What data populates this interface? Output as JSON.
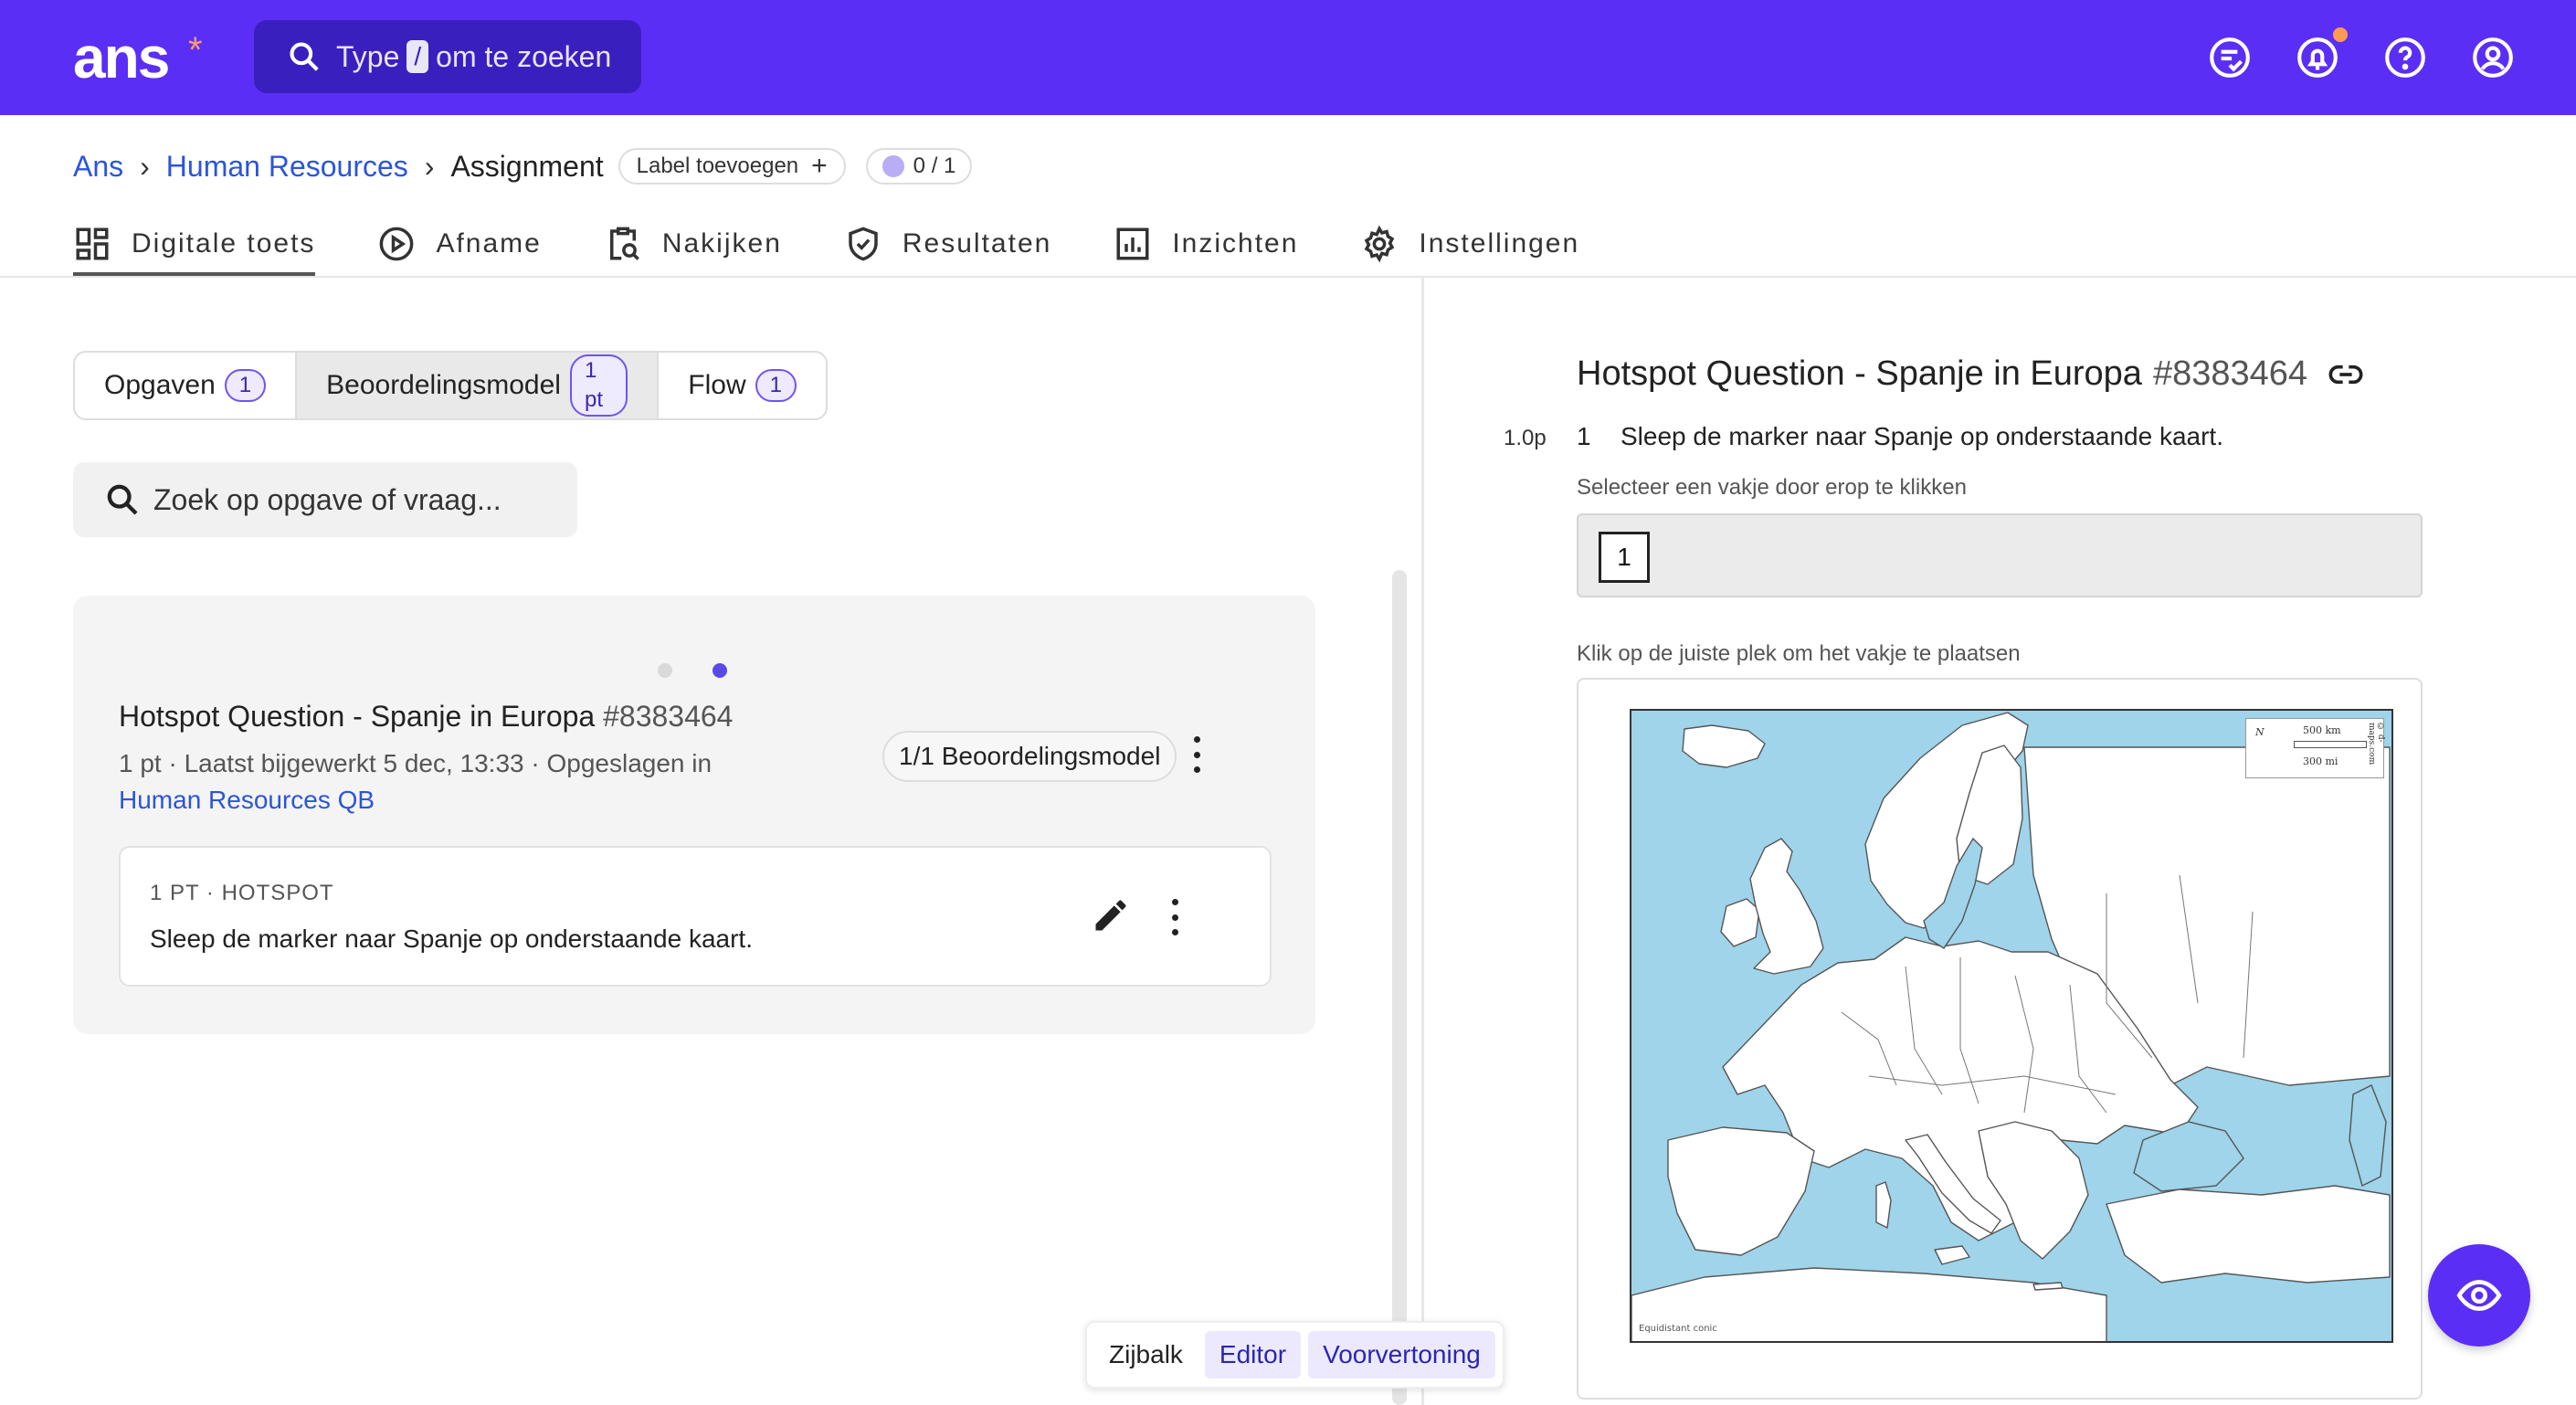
{
  "app": {
    "logo": "ans",
    "logo_mark": "*"
  },
  "top_search": {
    "prefix": "Type",
    "key": "/",
    "suffix": "om te zoeken"
  },
  "breadcrumb": {
    "items": [
      "Ans",
      "Human Resources"
    ],
    "current": "Assignment",
    "label_button": "Label toevoegen",
    "progress": "0 / 1"
  },
  "tabs": [
    {
      "label": "Digitale toets",
      "icon": "grid-icon",
      "active": true
    },
    {
      "label": "Afname",
      "icon": "play-icon"
    },
    {
      "label": "Nakijken",
      "icon": "clipboard-search-icon"
    },
    {
      "label": "Resultaten",
      "icon": "shield-check-icon"
    },
    {
      "label": "Inzichten",
      "icon": "bar-chart-icon"
    },
    {
      "label": "Instellingen",
      "icon": "gear-icon"
    }
  ],
  "segments": [
    {
      "label": "Opgaven",
      "badge": "1"
    },
    {
      "label": "Beoordelingsmodel",
      "badge": "1 pt",
      "active": true
    },
    {
      "label": "Flow",
      "badge": "1"
    }
  ],
  "question_search": {
    "placeholder": "Zoek op opgave of vraag..."
  },
  "question_card": {
    "title": "Hotspot Question - Spanje in Europa",
    "id": "#8383464",
    "meta": "1 pt · Laatst bijgewerkt 5 dec, 13:33 · Opgeslagen in",
    "bank": "Human Resources QB",
    "model_chip": "1/1 Beoordelingsmodel",
    "sub": {
      "type": "1 PT · HOTSPOT",
      "text": "Sleep de marker naar Spanje op onderstaande kaart."
    }
  },
  "view_toggle": {
    "zijbalk": "Zijbalk",
    "editor": "Editor",
    "preview": "Voorvertoning"
  },
  "preview": {
    "title": "Hotspot Question - Spanje in Europa",
    "id": "#8383464",
    "points": "1.0p",
    "number": "1",
    "question": "Sleep de marker naar Spanje op onderstaande kaart.",
    "hint_select": "Selecteer een vakje door erop te klikken",
    "marker": "1",
    "hint_place": "Klik op de juiste plek om het vakje te plaatsen",
    "map_legend": {
      "north": "N",
      "km": "500 km",
      "mi": "300 mi",
      "source": "© d-maps.com",
      "projection": "Equidistant conic"
    }
  },
  "colors": {
    "brand": "#5b2ef5",
    "link": "#2b55d9",
    "sea": "#9fd4ea",
    "notification": "#ff9a52"
  }
}
